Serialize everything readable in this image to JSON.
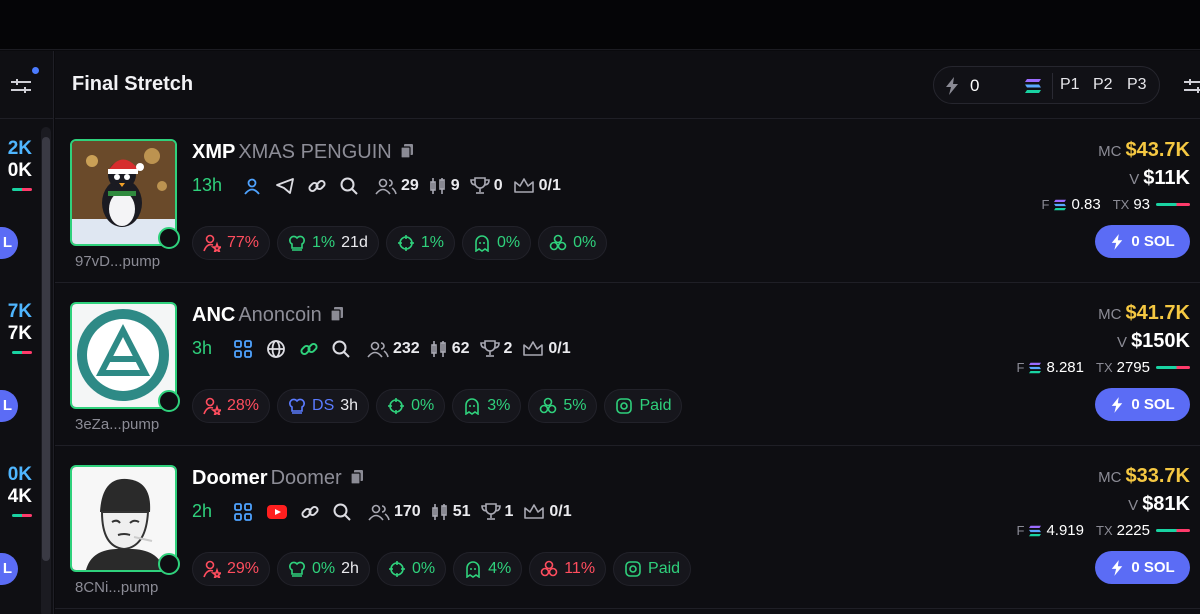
{
  "panel": {
    "title": "Final Stretch",
    "quick_amount": "0",
    "presets": [
      "P1",
      "P2",
      "P3"
    ],
    "active_preset": "P1"
  },
  "left_column": {
    "rows": [
      {
        "mc": "2K",
        "vol": "0K",
        "btn": "L"
      },
      {
        "mc": "7K",
        "vol": "7K",
        "btn": "L"
      },
      {
        "mc": "0K",
        "vol": "4K",
        "btn": "L"
      }
    ]
  },
  "tokens": [
    {
      "ticker": "XMP",
      "name": "XMAS PENGUIN",
      "age": "13h",
      "address": "97vD...pump",
      "holders": "29",
      "pro_traders": "9",
      "trophies": "0",
      "top10": "0/1",
      "chips": {
        "top10_pct": "77%",
        "dev_pct": "1%",
        "dev_age": "21d",
        "snipers": "1%",
        "insiders": "0%",
        "bundlers": "0%"
      },
      "mc": "$43.7K",
      "vol": "$11K",
      "fees": "0.83",
      "txs": "93",
      "buy_label": "0 SOL"
    },
    {
      "ticker": "ANC",
      "name": "Anoncoin",
      "age": "3h",
      "address": "3eZa...pump",
      "holders": "232",
      "pro_traders": "62",
      "trophies": "2",
      "top10": "0/1",
      "chips": {
        "top10_pct": "28%",
        "dev_label": "DS",
        "dev_age": "3h",
        "snipers": "0%",
        "insiders": "3%",
        "bundlers": "5%",
        "paid": "Paid"
      },
      "mc": "$41.7K",
      "vol": "$150K",
      "fees": "8.281",
      "txs": "2795",
      "buy_label": "0 SOL"
    },
    {
      "ticker": "Doomer",
      "name": "Doomer",
      "age": "2h",
      "address": "8CNi...pump",
      "holders": "170",
      "pro_traders": "51",
      "trophies": "1",
      "top10": "0/1",
      "chips": {
        "top10_pct": "29%",
        "dev_pct": "0%",
        "dev_age": "2h",
        "snipers": "0%",
        "insiders": "4%",
        "bundlers": "11%",
        "paid": "Paid"
      },
      "mc": "$33.7K",
      "vol": "$81K",
      "fees": "4.919",
      "txs": "2225",
      "buy_label": "0 SOL"
    }
  ],
  "labels": {
    "mc": "MC",
    "vol": "V",
    "fees": "F",
    "txs": "TX"
  },
  "colors": {
    "accent": "#5b6cf5",
    "green": "#2fd17c",
    "red": "#ff4d5e",
    "gold": "#f5c842",
    "blue": "#4fb6ff"
  }
}
